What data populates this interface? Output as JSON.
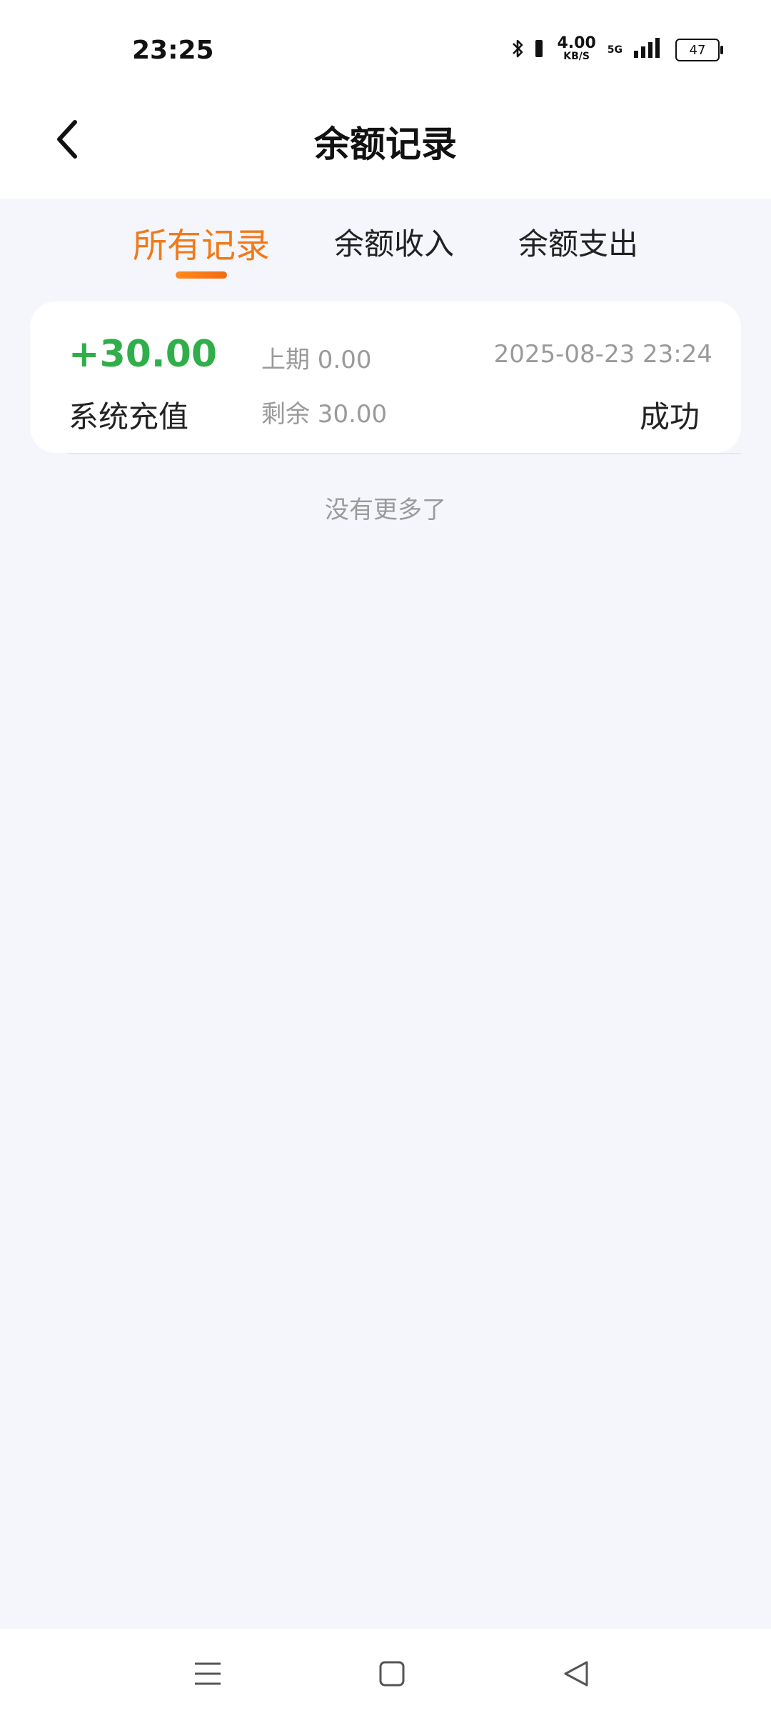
{
  "status_bar": {
    "time": "23:25",
    "net_speed_value": "4.00",
    "net_speed_unit": "KB/S",
    "network_type": "5G",
    "battery_level": "47",
    "icons": [
      "bluetooth-icon",
      "signal-bars-icon",
      "battery-icon"
    ]
  },
  "header": {
    "title": "余额记录",
    "back_icon": "chevron-left-icon"
  },
  "tabs": {
    "items": [
      {
        "label": "所有记录",
        "active": true
      },
      {
        "label": "余额收入",
        "active": false
      },
      {
        "label": "余额支出",
        "active": false
      }
    ],
    "active_color": "#f07a1a"
  },
  "records": [
    {
      "amount": "+30.00",
      "amount_color": "#2fae4a",
      "type": "系统充值",
      "previous": "上期 0.00",
      "remaining": "剩余 30.00",
      "time": "2025-08-23 23:24",
      "status": "成功"
    }
  ],
  "list_footer": "没有更多了",
  "nav_bar": {
    "icons": [
      "menu-icon",
      "home-square-icon",
      "back-triangle-icon"
    ]
  }
}
